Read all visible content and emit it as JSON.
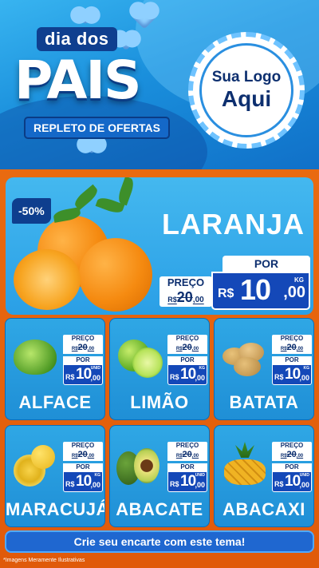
{
  "header": {
    "dia": "dia dos",
    "pais": "PAIS",
    "repleto": "REPLETO DE OFERTAS",
    "logo_line1": "Sua Logo",
    "logo_line2": "Aqui"
  },
  "hero": {
    "discount": "-50%",
    "name": "LARANJA",
    "preco_label": "PREÇO",
    "old_price_prefix": "R$",
    "old_price": "20",
    "old_price_cents": ",00",
    "por_label": "POR",
    "currency": "R$",
    "new_price": "10",
    "new_price_cents": ",00",
    "unit": "KG"
  },
  "products": [
    {
      "name": "ALFACE",
      "preco_label": "PREÇO",
      "old_prefix": "R$",
      "old": "20",
      "old_cents": ",00",
      "por_label": "POR",
      "currency": "R$",
      "price": "10",
      "cents": ",00",
      "unit": "UNID"
    },
    {
      "name": "LIMÃO",
      "preco_label": "PREÇO",
      "old_prefix": "R$",
      "old": "20",
      "old_cents": ",00",
      "por_label": "POR",
      "currency": "R$",
      "price": "10",
      "cents": ",00",
      "unit": "KG"
    },
    {
      "name": "BATATA",
      "preco_label": "PREÇO",
      "old_prefix": "R$",
      "old": "20",
      "old_cents": ",00",
      "por_label": "POR",
      "currency": "R$",
      "price": "10",
      "cents": ",00",
      "unit": "KG"
    },
    {
      "name": "MARACUJÁ",
      "preco_label": "PREÇO",
      "old_prefix": "R$",
      "old": "20",
      "old_cents": ",00",
      "por_label": "POR",
      "currency": "R$",
      "price": "10",
      "cents": ",00",
      "unit": "KG"
    },
    {
      "name": "ABACATE",
      "preco_label": "PREÇO",
      "old_prefix": "R$",
      "old": "20",
      "old_cents": ",00",
      "por_label": "POR",
      "currency": "R$",
      "price": "10",
      "cents": ",00",
      "unit": "UNID"
    },
    {
      "name": "ABACAXI",
      "preco_label": "PREÇO",
      "old_prefix": "R$",
      "old": "20",
      "old_cents": ",00",
      "por_label": "POR",
      "currency": "R$",
      "price": "10",
      "cents": ",00",
      "unit": "UNID"
    }
  ],
  "cta": "Crie seu encarte com este tema!",
  "footnote": "*Imagens Meramente Ilustrativas",
  "colors": {
    "brand_blue": "#1448b8",
    "sky": "#2fa7e5",
    "orange": "#e8620f"
  }
}
